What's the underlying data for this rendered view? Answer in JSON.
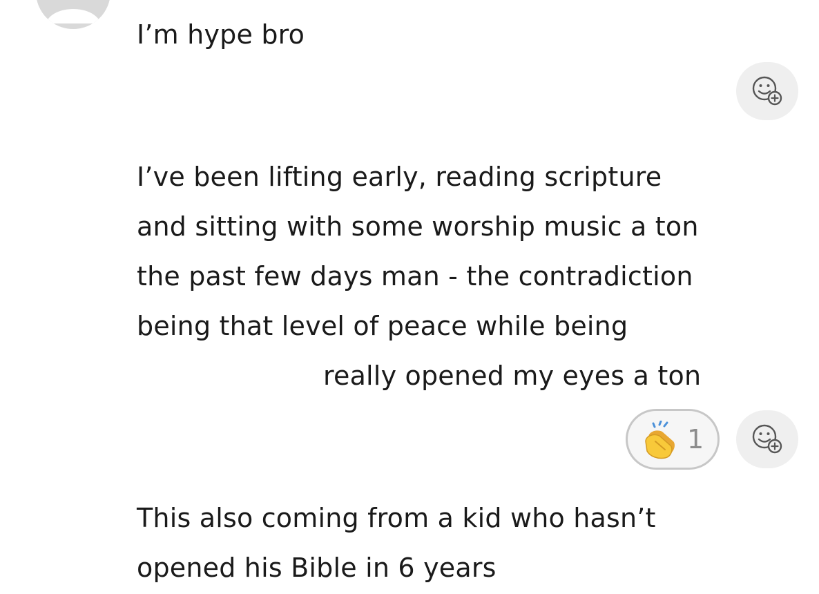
{
  "messages": [
    {
      "lines": [
        "I’m hype bro"
      ]
    },
    {
      "lines": [
        "I’ve been lifting early, reading scripture",
        "and sitting with some worship music a ton",
        "the past few days man - the contradiction",
        "being that level of peace while being",
        "really opened my eyes a ton"
      ]
    },
    {
      "lines": [
        "This also coming from a kid who hasn’t",
        "opened his Bible in 6 years"
      ]
    }
  ],
  "reactions": {
    "message_2": {
      "emoji": "clapping-hands",
      "count": "1"
    }
  },
  "icons": {
    "add_reaction": "add-reaction-icon",
    "avatar": "default-avatar-icon"
  },
  "colors": {
    "text": "#1a1a1a",
    "reaction_button_bg": "#efefef",
    "pill_border": "#c7c7c7",
    "count_text": "#8c8c8c",
    "avatar_bg": "#d9d9d9"
  }
}
